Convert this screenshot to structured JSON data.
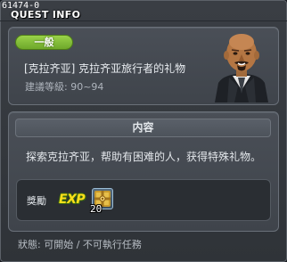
{
  "quest_id": "61474-0",
  "window_title": "QUEST INFO",
  "quest": {
    "type_badge": "一般",
    "name": "[克拉齐亚] 克拉齐亚旅行者的礼物",
    "level_range": "建議等級: 90~94"
  },
  "content": {
    "header": "内容",
    "description": "探索克拉齐亚，帮助有困难的人，获得特殊礼物。"
  },
  "reward": {
    "label": "獎勵",
    "exp_label": "EXP",
    "item_quantity": "20"
  },
  "status_text": "狀態: 可開始 / 不可執行任務",
  "colors": {
    "badge_green": "#8cc63e",
    "exp_yellow": "#ffdf1a",
    "panel_bg": "#454a51"
  },
  "icons": {
    "npc": "npc-portrait-icon",
    "reward_item": "gift-box-icon"
  }
}
